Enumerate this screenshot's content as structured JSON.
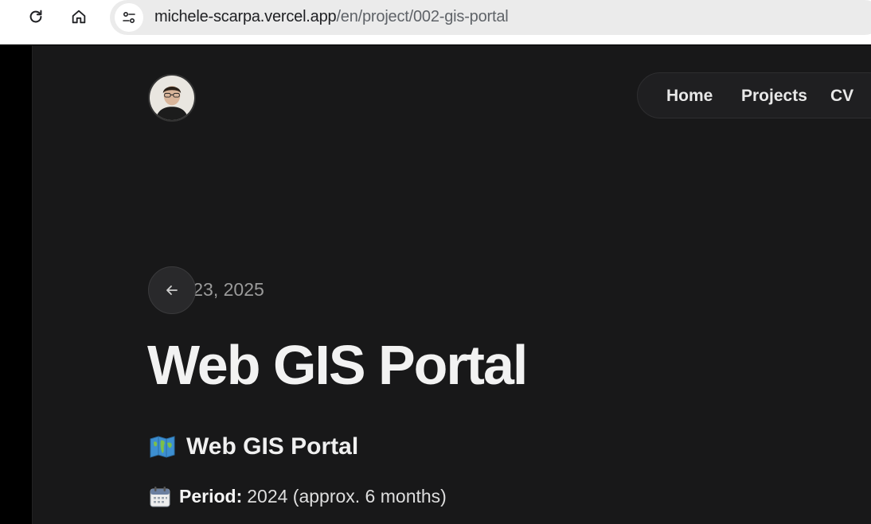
{
  "browser": {
    "url_host": "michele-scarpa.vercel.app",
    "url_path": "/en/project/002-gis-portal",
    "icons": {
      "reload": "reload-icon",
      "home": "home-icon",
      "site_info": "tune-icon"
    }
  },
  "nav": {
    "items": [
      {
        "label": "Home"
      },
      {
        "label": "Projects"
      },
      {
        "label": "CV"
      }
    ]
  },
  "article": {
    "date": "June 23, 2025",
    "title": "Web GIS Portal",
    "heading": "Web GIS Portal",
    "heading_icon": "world-map-emoji",
    "period_icon": "calendar-emoji",
    "period_label": "Period:",
    "period_value": "2024 (approx. 6 months)"
  },
  "colors": {
    "page_bg": "#181819",
    "text": "#f2f2f2",
    "muted": "#9a9a9a"
  }
}
